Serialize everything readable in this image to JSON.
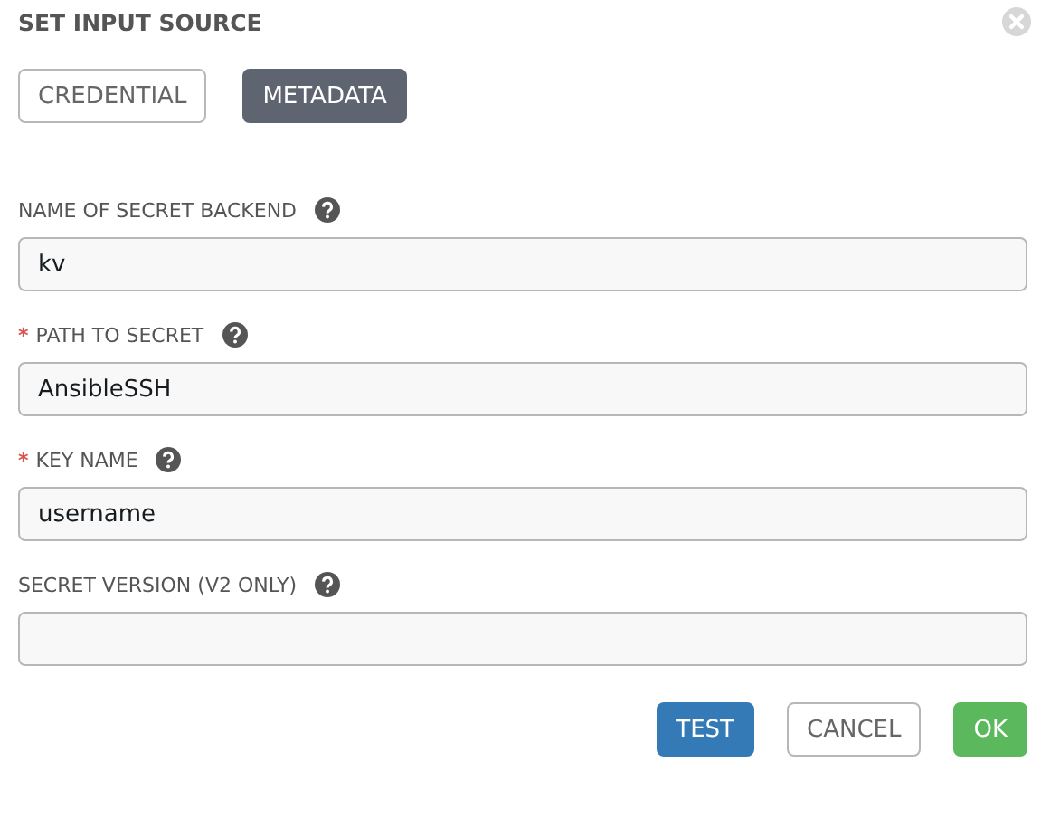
{
  "dialog": {
    "title": "SET INPUT SOURCE"
  },
  "tabs": [
    {
      "label": "CREDENTIAL",
      "selected": false
    },
    {
      "label": "METADATA",
      "selected": true
    }
  ],
  "fields": [
    {
      "label": "NAME OF SECRET BACKEND",
      "required": false,
      "value": "kv"
    },
    {
      "label": "PATH TO SECRET",
      "required": true,
      "value": "AnsibleSSH"
    },
    {
      "label": "KEY NAME",
      "required": true,
      "value": "username"
    },
    {
      "label": "SECRET VERSION (V2 ONLY)",
      "required": false
    }
  ],
  "required_mark": "*",
  "buttons": [
    {
      "label": "TEST",
      "kind": "primary"
    },
    {
      "label": "CANCEL",
      "kind": "default"
    },
    {
      "label": "OK",
      "kind": "success"
    }
  ]
}
